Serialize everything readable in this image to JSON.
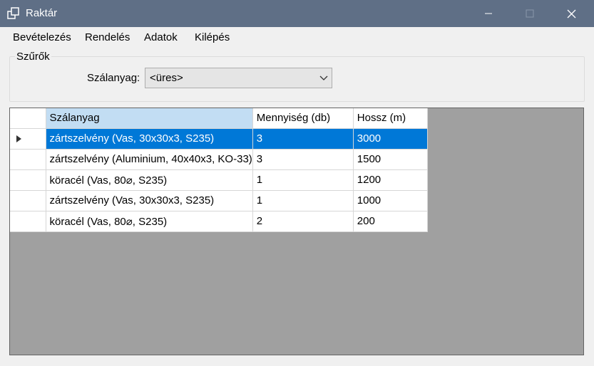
{
  "window": {
    "title": "Raktár"
  },
  "menu": [
    "Bevételezés",
    "Rendelés",
    "Adatok",
    "Kilépés"
  ],
  "filters": {
    "group_title": "Szűrők",
    "material_label": "Szálanyag:",
    "material_value": "<üres>"
  },
  "grid": {
    "columns": [
      "Szálanyag",
      "Mennyiség (db)",
      "Hossz (m)"
    ],
    "rows": [
      {
        "material": "zártszelvény (Vas, 30x30x3, S235)",
        "quantity": "3",
        "length": "3000",
        "selected": true
      },
      {
        "material": "zártszelvény (Aluminium, 40x40x3, KO-33)",
        "quantity": "3",
        "length": "1500",
        "selected": false
      },
      {
        "material": "köracél (Vas, 80⌀, S235)",
        "quantity": "1",
        "length": "1200",
        "selected": false
      },
      {
        "material": "zártszelvény (Vas, 30x30x3, S235)",
        "quantity": "1",
        "length": "1000",
        "selected": false
      },
      {
        "material": "köracél (Vas, 80⌀, S235)",
        "quantity": "2",
        "length": "200",
        "selected": false
      }
    ]
  },
  "colors": {
    "titlebar": "#5f6f86",
    "selection": "#0078d7",
    "header_selected": "#c2ddf3",
    "grid_background": "#a0a0a0"
  }
}
